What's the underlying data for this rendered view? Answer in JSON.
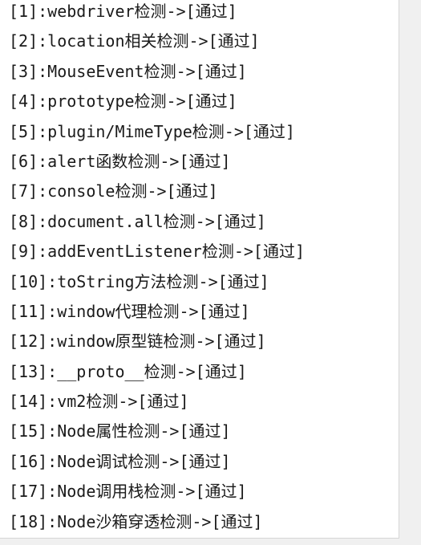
{
  "log": {
    "lines": [
      "[1]:webdriver检测->[通过]",
      "[2]:location相关检测->[通过]",
      "[3]:MouseEvent检测->[通过]",
      "[4]:prototype检测->[通过]",
      "[5]:plugin/MimeType检测->[通过]",
      "[6]:alert函数检测->[通过]",
      "[7]:console检测->[通过]",
      "[8]:document.all检测->[通过]",
      "[9]:addEventListener检测->[通过]",
      "[10]:toString方法检测->[通过]",
      "[11]:window代理检测->[通过]",
      "[12]:window原型链检测->[通过]",
      "[13]:__proto__检测->[通过]",
      "[14]:vm2检测->[通过]",
      "[15]:Node属性检测->[通过]",
      "[16]:Node调试检测->[通过]",
      "[17]:Node调用栈检测->[通过]",
      "[18]:Node沙箱穿透检测->[通过]"
    ]
  }
}
